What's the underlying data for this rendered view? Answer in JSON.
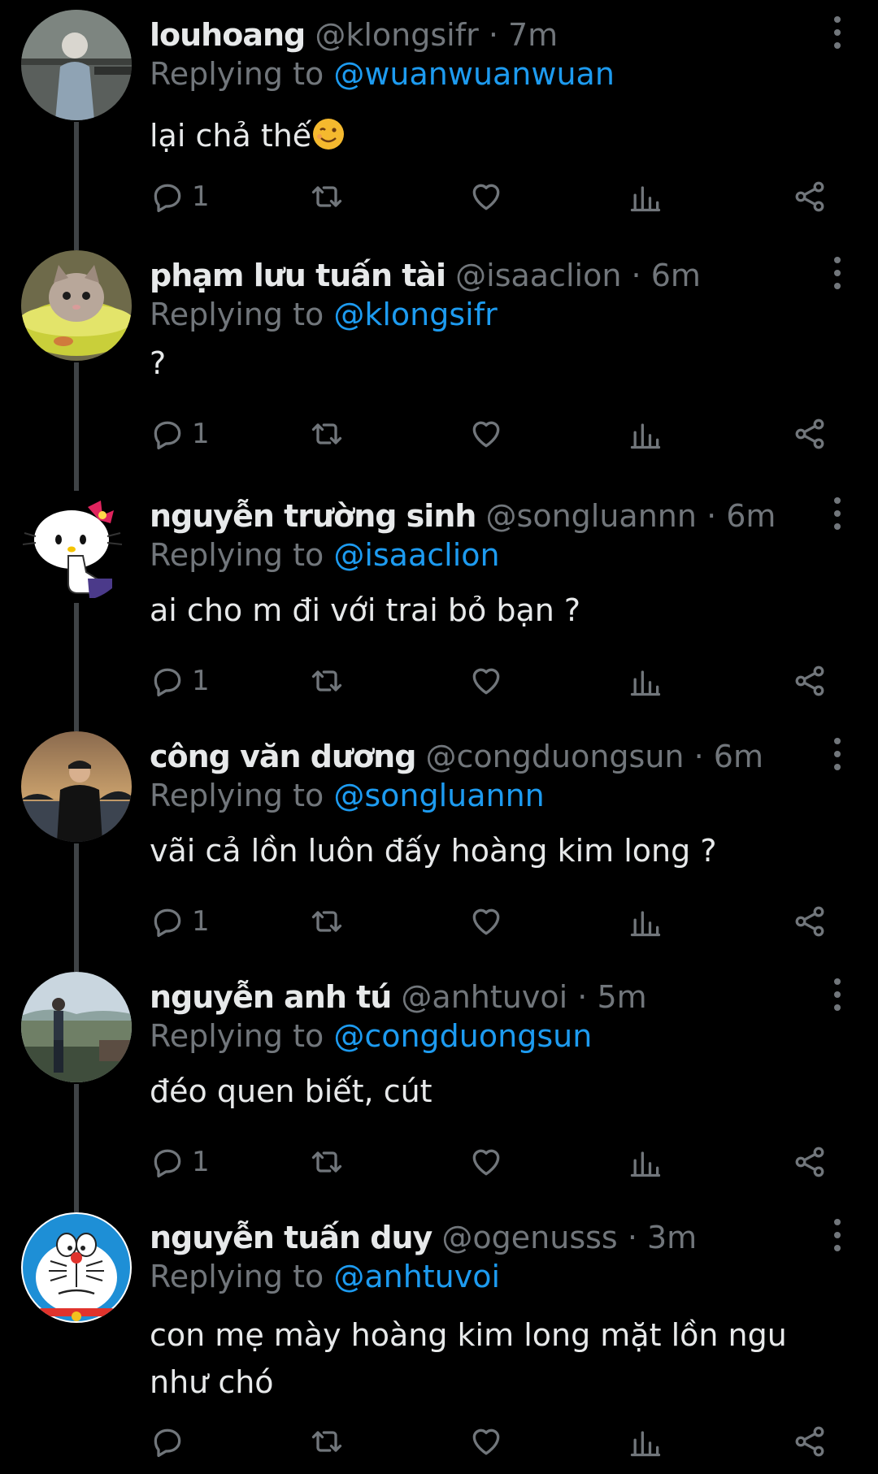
{
  "colors": {
    "background": "#000000",
    "text": "#e7e9ea",
    "muted": "#71767b",
    "link": "#1d9bf0"
  },
  "tweets": [
    {
      "name": "louhoang",
      "handle": "@klongsifr",
      "separator": "·",
      "time": "7m",
      "reply_prefix": "Replying to",
      "reply_to": "@wuanwuanwuan",
      "text": "lại chả thế",
      "emoji": "winking-face",
      "reply_count": "1"
    },
    {
      "name": "phạm lưu tuấn tài",
      "handle": "@isaaclion",
      "separator": "·",
      "time": "6m",
      "reply_prefix": "Replying to",
      "reply_to": "@klongsifr",
      "text": "?",
      "reply_count": "1"
    },
    {
      "name": "nguyễn trường sinh",
      "handle": "@songluannn",
      "separator": "·",
      "time": "6m",
      "reply_prefix": "Replying to",
      "reply_to": "@isaaclion",
      "text": "ai cho m đi với trai bỏ bạn ?",
      "reply_count": "1"
    },
    {
      "name": "công văn dương",
      "handle": "@congduongsun",
      "separator": "·",
      "time": "6m",
      "reply_prefix": "Replying to",
      "reply_to": "@songluannn",
      "text": "vãi cả lồn luôn đấy hoàng kim long ?",
      "reply_count": "1"
    },
    {
      "name": "nguyễn anh tú",
      "handle": "@anhtuvoi",
      "separator": "·",
      "time": "5m",
      "reply_prefix": "Replying to",
      "reply_to": "@congduongsun",
      "text": "đéo quen biết, cút",
      "reply_count": "1"
    },
    {
      "name": "nguyễn tuấn duy",
      "handle": "@ogenusss",
      "separator": "·",
      "time": "3m",
      "reply_prefix": "Replying to",
      "reply_to": "@anhtuvoi",
      "text": "con mẹ mày hoàng kim long mặt lồn ngu như chó",
      "reply_count": ""
    }
  ]
}
